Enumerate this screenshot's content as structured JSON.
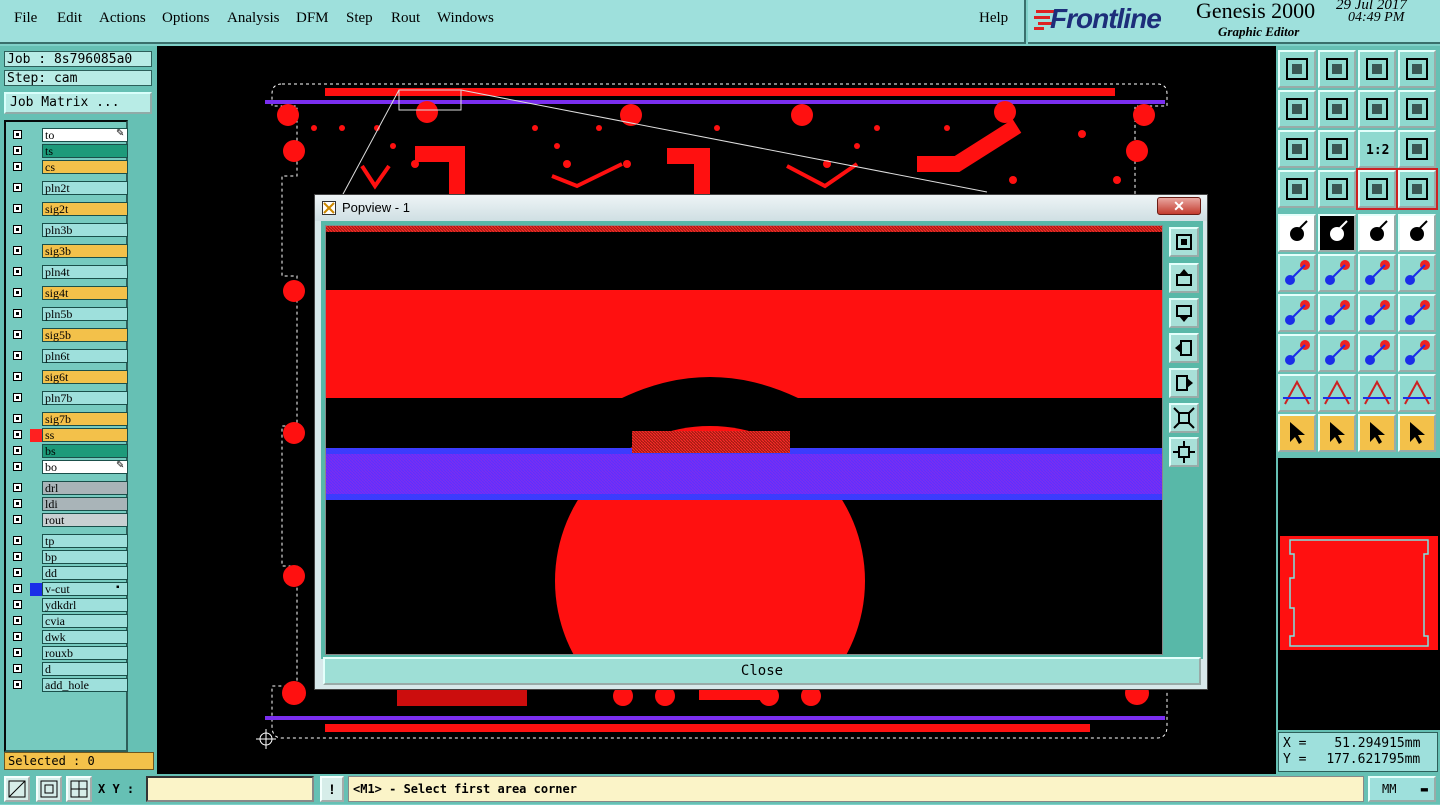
{
  "menu": {
    "items": [
      "File",
      "Edit",
      "Actions",
      "Options",
      "Analysis",
      "DFM",
      "Step",
      "Rout",
      "Windows"
    ],
    "help": "Help"
  },
  "branding": {
    "logo": "Frontline",
    "product": "Genesis 2000",
    "subtitle": "Graphic Editor",
    "date": "29 Jul 2017",
    "time": "04:49 PM"
  },
  "job": {
    "job_label": "Job : 8s796085a0",
    "step_label": "Step: cam",
    "job_matrix_button": "Job Matrix ..."
  },
  "layers": [
    {
      "name": "to",
      "bg": "#ffffff",
      "swatch": null,
      "mark": "✎"
    },
    {
      "name": "ts",
      "bg": "#1d9a7a",
      "swatch": null,
      "mark": ""
    },
    {
      "name": "cs",
      "bg": "#f3c14a",
      "swatch": null,
      "mark": ""
    },
    {
      "name": "pln2t",
      "bg": "#9ee0dc",
      "swatch": null,
      "mark": ""
    },
    {
      "name": "sig2t",
      "bg": "#f3c14a",
      "swatch": null,
      "mark": ""
    },
    {
      "name": "pln3b",
      "bg": "#9ee0dc",
      "swatch": null,
      "mark": ""
    },
    {
      "name": "sig3b",
      "bg": "#f3c14a",
      "swatch": null,
      "mark": ""
    },
    {
      "name": "pln4t",
      "bg": "#9ee0dc",
      "swatch": null,
      "mark": ""
    },
    {
      "name": "sig4t",
      "bg": "#f3c14a",
      "swatch": null,
      "mark": ""
    },
    {
      "name": "pln5b",
      "bg": "#9ee0dc",
      "swatch": null,
      "mark": ""
    },
    {
      "name": "sig5b",
      "bg": "#f3c14a",
      "swatch": null,
      "mark": ""
    },
    {
      "name": "pln6t",
      "bg": "#9ee0dc",
      "swatch": null,
      "mark": ""
    },
    {
      "name": "sig6t",
      "bg": "#f3c14a",
      "swatch": null,
      "mark": ""
    },
    {
      "name": "pln7b",
      "bg": "#9ee0dc",
      "swatch": null,
      "mark": ""
    },
    {
      "name": "sig7b",
      "bg": "#f3c14a",
      "swatch": null,
      "mark": ""
    },
    {
      "name": "ss",
      "bg": "#f3c14a",
      "swatch": "#ff2020",
      "mark": ""
    },
    {
      "name": "bs",
      "bg": "#1d9a7a",
      "swatch": null,
      "mark": ""
    },
    {
      "name": "bo",
      "bg": "#ffffff",
      "swatch": null,
      "mark": "✎"
    },
    {
      "name": "drl",
      "bg": "#a9b4b8",
      "swatch": null,
      "mark": ""
    },
    {
      "name": "ldi",
      "bg": "#a9b4b8",
      "swatch": null,
      "mark": ""
    },
    {
      "name": "rout",
      "bg": "#c9d0d2",
      "swatch": null,
      "mark": ""
    },
    {
      "name": "tp",
      "bg": "#9ee0dc",
      "swatch": null,
      "mark": ""
    },
    {
      "name": "bp",
      "bg": "#9ee0dc",
      "swatch": null,
      "mark": ""
    },
    {
      "name": "dd",
      "bg": "#9ee0dc",
      "swatch": null,
      "mark": ""
    },
    {
      "name": "v-cut",
      "bg": "#9ee0dc",
      "swatch": "#1a2ee8",
      "mark": "▪"
    },
    {
      "name": "ydkdrl",
      "bg": "#9ee0dc",
      "swatch": null,
      "mark": ""
    },
    {
      "name": "cvia",
      "bg": "#9ee0dc",
      "swatch": null,
      "mark": ""
    },
    {
      "name": "dwk",
      "bg": "#9ee0dc",
      "swatch": null,
      "mark": ""
    },
    {
      "name": "rouxb",
      "bg": "#9ee0dc",
      "swatch": null,
      "mark": ""
    },
    {
      "name": "d",
      "bg": "#9ee0dc",
      "swatch": null,
      "mark": ""
    },
    {
      "name": "add_hole",
      "bg": "#9ee0dc",
      "swatch": null,
      "mark": ""
    }
  ],
  "selected": "Selected : 0",
  "popview": {
    "title": "Popview - 1",
    "close_button": "Close",
    "close_x": "✕"
  },
  "toolbox": {
    "rows": [
      [
        "view-top-icon",
        "view-bottom-icon",
        "home-view-icon",
        "grid-corner-icon"
      ],
      [
        "pan-left-icon",
        "pan-right-icon",
        "swap-view-icon",
        "snap-s-icon"
      ],
      [
        "fit-view-icon",
        "zoom-center-icon",
        "scale-1-2-icon",
        "help-query-icon"
      ],
      [
        "measure-tool-icon",
        "grid-toggle-icon",
        "net-highlight-icon",
        "net-check-icon"
      ],
      [
        "add-pad-icon",
        "line-draw-icon",
        "ruler-icon",
        "dot-frame-icon"
      ],
      [
        "add-nodes-icon",
        "delete-node-icon",
        "move-arc-icon",
        "add-arc-icon"
      ],
      [
        "angle-tool-icon",
        "draw-line-icon",
        "rotate-icon",
        "text-tool-icon"
      ],
      [
        "pad-add-icon",
        "cut-line-icon",
        "stretch-icon",
        "shape-combine-icon"
      ],
      [
        "trace-a-icon",
        "trace-b-icon",
        "trace-c-icon",
        "trace-d-icon"
      ],
      [
        "select-arrow-icon",
        "select-box-icon",
        "select-pointer-icon",
        "select-net-icon"
      ]
    ],
    "scale_label": "1:2"
  },
  "coords": {
    "x_label": "X =",
    "x_value": "51.294915mm",
    "y_label": "Y =",
    "y_value": "177.621795mm"
  },
  "bottombar": {
    "xy_label": "X Y :",
    "xy_value": "",
    "exclaim": "!",
    "status": "<M1> - Select first area corner",
    "units": "MM"
  },
  "colors": {
    "pcb_copper": "#ff1010",
    "vcut_band": "#7a2ef0",
    "panel_teal": "#66c0b4",
    "layer_orange": "#f3c14a"
  }
}
